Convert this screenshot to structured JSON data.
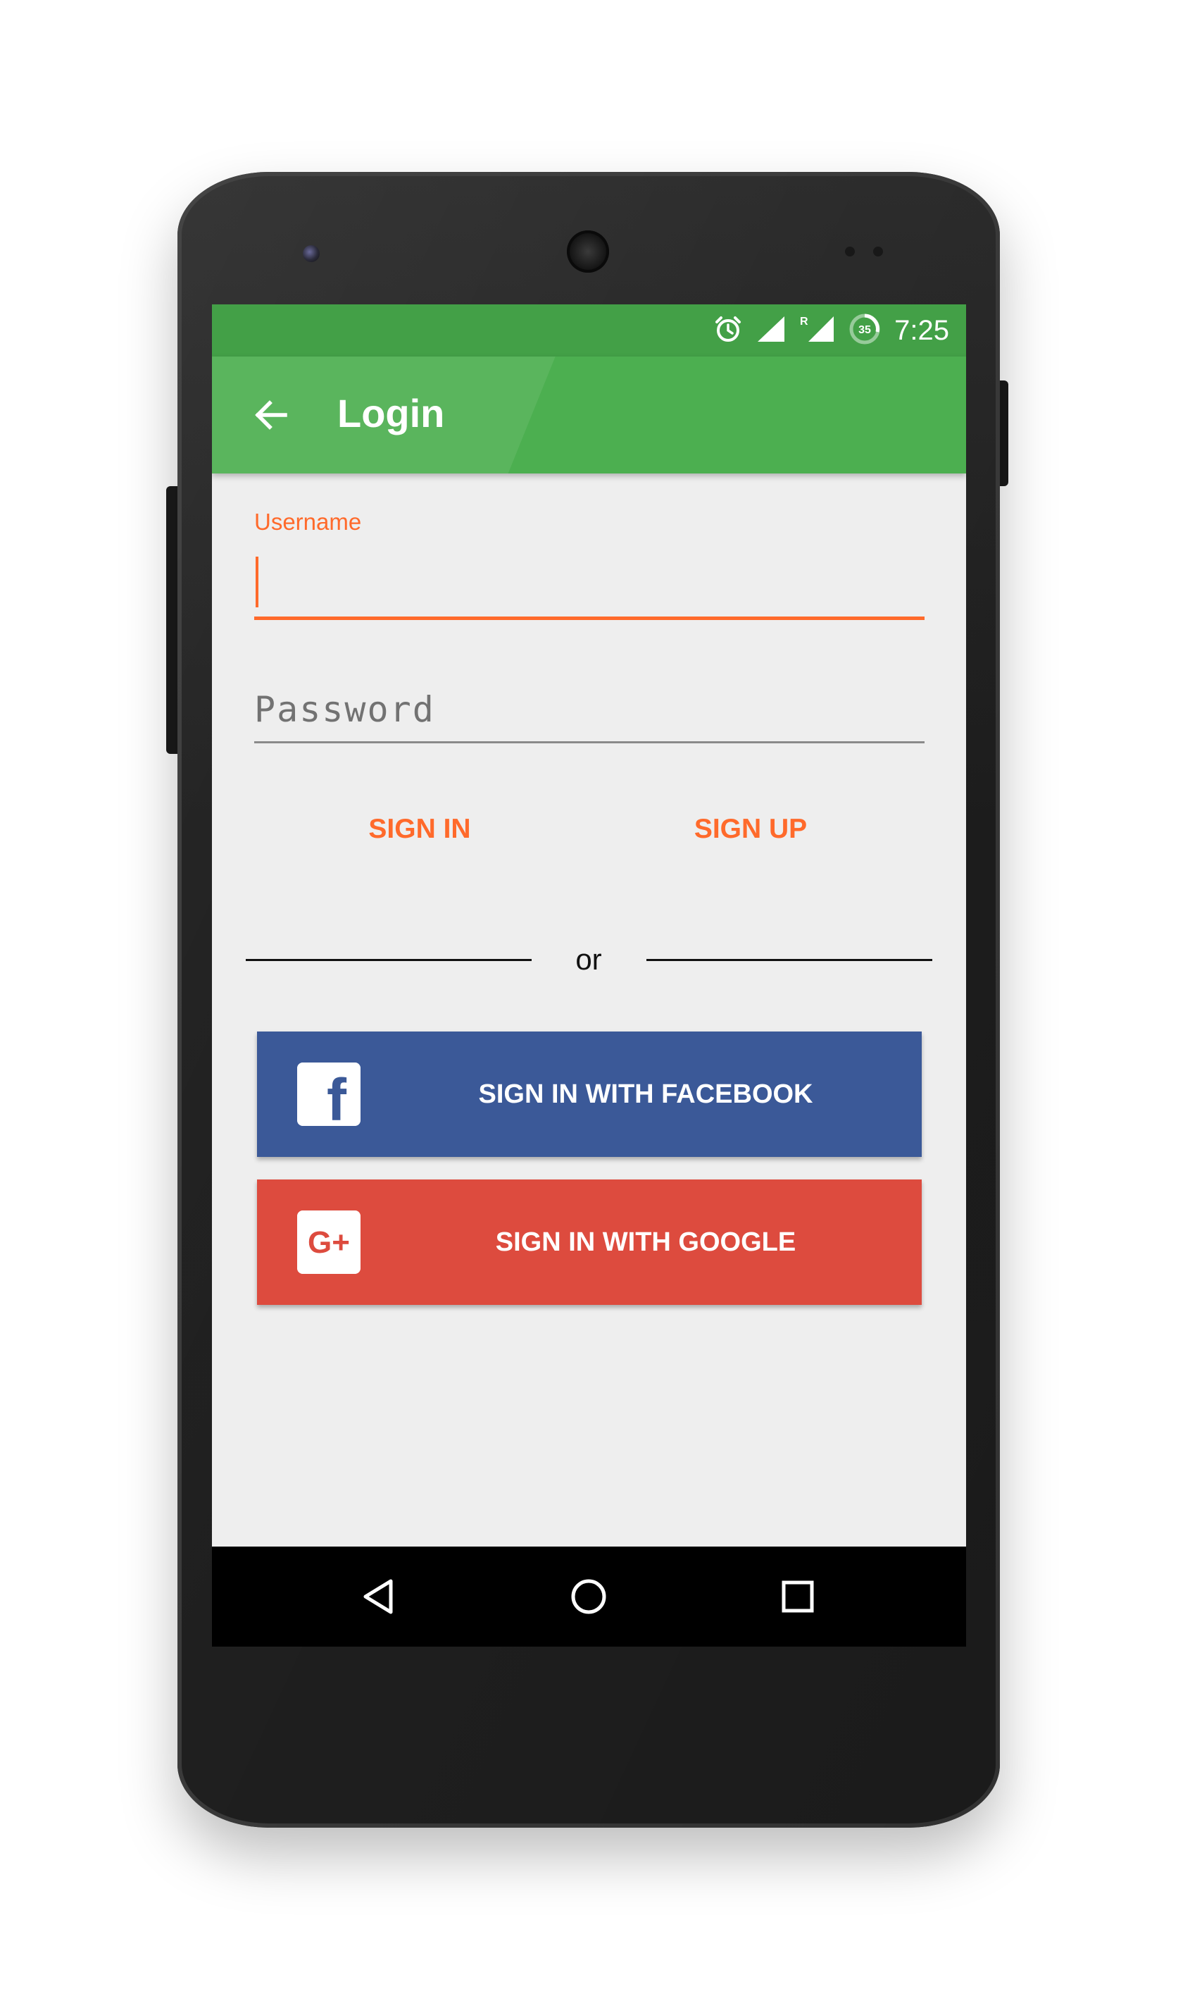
{
  "statusbar": {
    "time": "7:25",
    "icons": [
      "alarm-icon",
      "signal-icon",
      "roaming-signal-icon",
      "battery-icon"
    ],
    "battery_level": "35"
  },
  "toolbar": {
    "title": "Login",
    "back_icon": "arrow-back-icon"
  },
  "form": {
    "username_label": "Username",
    "username_value": "",
    "password_placeholder": "Password",
    "signin_label": "SIGN IN",
    "signup_label": "SIGN UP",
    "divider_text": "or"
  },
  "social": {
    "facebook_label": "SIGN IN WITH FACEBOOK",
    "facebook_icon_text": "f",
    "google_label": "SIGN IN WITH GOOGLE",
    "google_icon_text": "G+"
  },
  "navbar": {
    "back": "nav-back-icon",
    "home": "nav-home-icon",
    "recents": "nav-recents-icon"
  },
  "colors": {
    "statusbar": "#43a047",
    "toolbar": "#4caf50",
    "accent": "#ff6a2b",
    "facebook": "#3b5998",
    "google": "#dd4b3e",
    "screen_bg": "#eeeeee"
  }
}
